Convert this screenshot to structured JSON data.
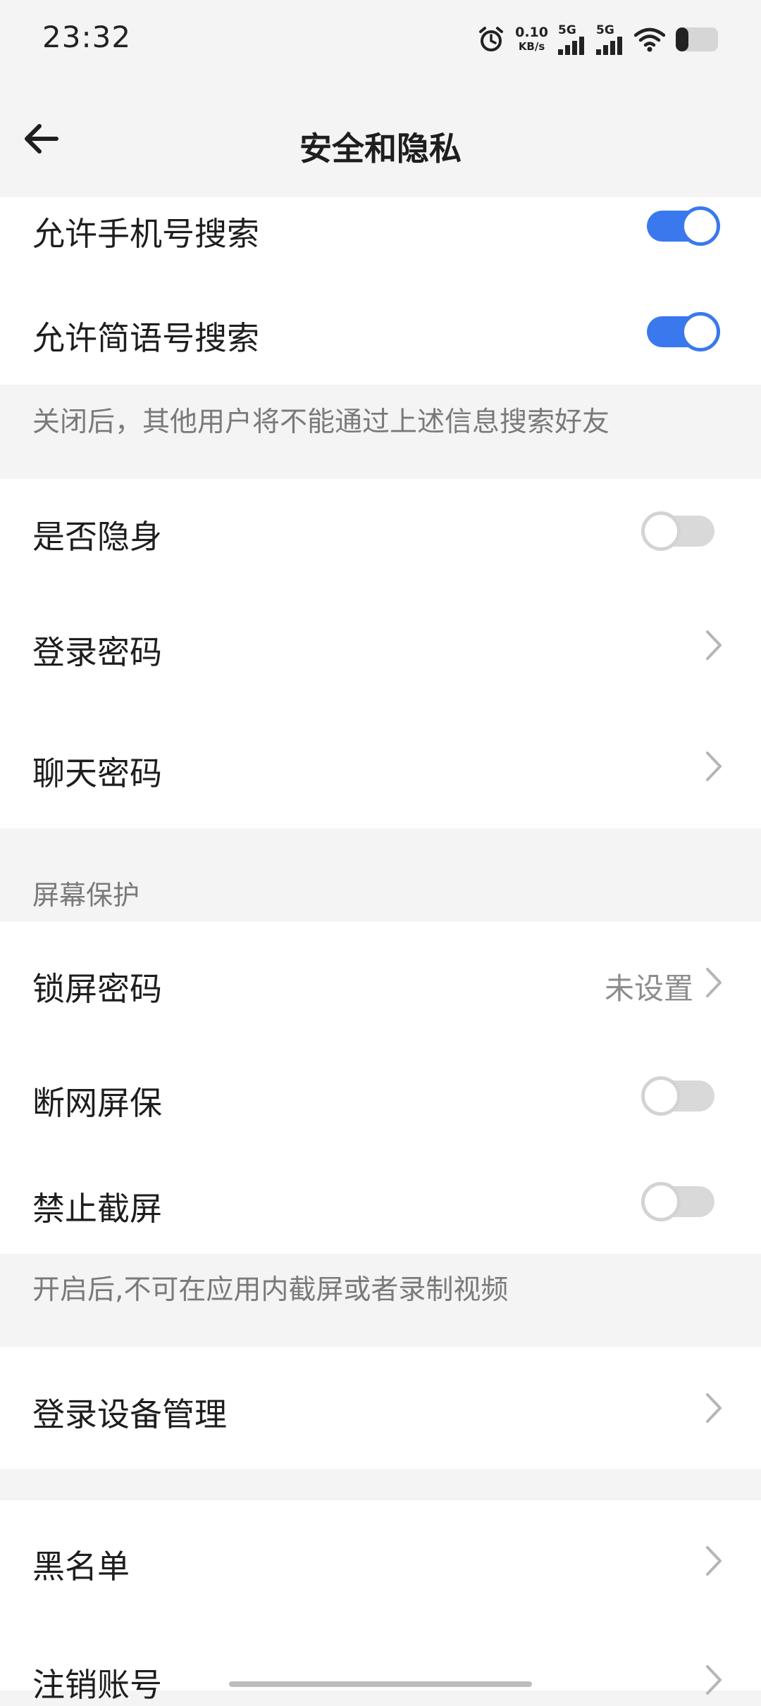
{
  "status_bar": {
    "time": "23:32",
    "net_speed_value": "0.10",
    "net_speed_unit": "KB/s",
    "signal1_label": "5G",
    "signal2_label": "5G",
    "battery_level": 0.3
  },
  "header": {
    "title": "安全和隐私",
    "back_icon": "arrow-left-icon"
  },
  "search_settings": {
    "phone_search_label": "允许手机号搜索",
    "phone_search_on": true,
    "jianyu_search_label": "允许简语号搜索",
    "jianyu_search_on": true,
    "hint": "关闭后，其他用户将不能通过上述信息搜索好友"
  },
  "account_settings": {
    "invisible_label": "是否隐身",
    "invisible_on": false,
    "login_password_label": "登录密码",
    "chat_password_label": "聊天密码"
  },
  "screen_protection": {
    "section_title": "屏幕保护",
    "lock_password_label": "锁屏密码",
    "lock_password_value": "未设置",
    "offline_screensaver_label": "断网屏保",
    "offline_screensaver_on": false,
    "block_screenshot_label": "禁止截屏",
    "block_screenshot_on": false,
    "hint": "开启后,不可在应用内截屏或者录制视频"
  },
  "device": {
    "device_manage_label": "登录设备管理"
  },
  "misc": {
    "blacklist_label": "黑名单",
    "cancel_account_label": "注销账号"
  },
  "colors": {
    "accent": "#3a78ee",
    "background": "#f4f4f4",
    "card": "#ffffff"
  }
}
